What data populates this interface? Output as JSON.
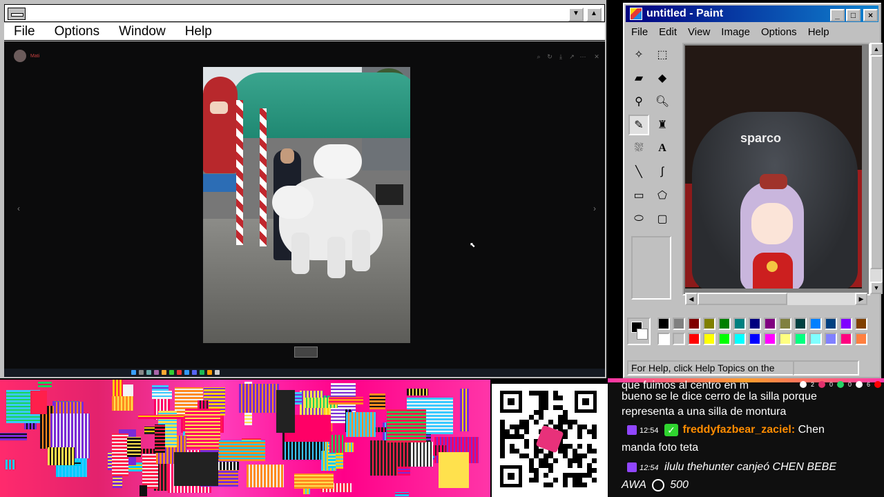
{
  "left_window": {
    "menu": [
      "File",
      "Options",
      "Window",
      "Help"
    ],
    "title_buttons": {
      "minimize": "▼",
      "maximize": "▲"
    }
  },
  "photo_viewer": {
    "user_name": "Mati",
    "nav_prev": "‹",
    "nav_next": "›",
    "close": "✕"
  },
  "paint": {
    "title": "untitled - Paint",
    "menu": [
      "File",
      "Edit",
      "View",
      "Image",
      "Options",
      "Help"
    ],
    "status_text": "For Help, click Help Topics on the",
    "canvas_logo": "sparco",
    "palette_top": [
      "#000000",
      "#808080",
      "#800000",
      "#808000",
      "#008000",
      "#008080",
      "#000080",
      "#800080",
      "#808040",
      "#004040",
      "#0080ff",
      "#004080",
      "#8000ff",
      "#804000"
    ],
    "palette_bottom": [
      "#ffffff",
      "#c0c0c0",
      "#ff0000",
      "#ffff00",
      "#00ff00",
      "#00ffff",
      "#0000ff",
      "#ff00ff",
      "#ffff80",
      "#00ff80",
      "#80ffff",
      "#8080ff",
      "#ff0080",
      "#ff8040"
    ],
    "tools": [
      "free-select",
      "rect-select",
      "eraser",
      "fill",
      "picker",
      "magnifier",
      "pencil",
      "brush",
      "airbrush",
      "text",
      "line",
      "curve",
      "rectangle",
      "polygon",
      "ellipse",
      "rounded-rect"
    ]
  },
  "chat": {
    "messages": [
      {
        "text": "que fuimos al centro en m"
      },
      {
        "text": "bueno se le dice cerro de la silla porque"
      },
      {
        "text": "representa a una silla de montura"
      },
      {
        "time": "12:54",
        "user": "freddyfazbear_zaciel:",
        "text": "Chen"
      },
      {
        "text": "manda foto teta"
      },
      {
        "time": "12:54",
        "redeem": "ilulu thehunter canjeó CHEN BEBE"
      },
      {
        "text": "AWA",
        "points": "500"
      }
    ],
    "top_counts": [
      "2",
      "0",
      "0",
      "6"
    ]
  }
}
